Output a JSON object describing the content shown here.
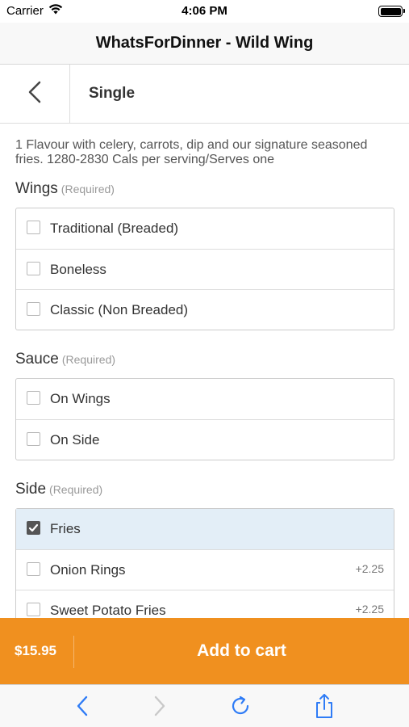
{
  "status_bar": {
    "carrier": "Carrier",
    "time": "4:06 PM"
  },
  "window": {
    "title": "WhatsForDinner - Wild Wing"
  },
  "header": {
    "title": "Single"
  },
  "description": "1 Flavour with celery, carrots, dip and our signature seasoned fries. 1280-2830 Cals per serving/Serves one",
  "groups": {
    "wings": {
      "label": "Wings",
      "required": "(Required)",
      "options": [
        {
          "label": "Traditional (Breaded)",
          "checked": false
        },
        {
          "label": "Boneless",
          "checked": false
        },
        {
          "label": "Classic (Non Breaded)",
          "checked": false
        }
      ]
    },
    "sauce": {
      "label": "Sauce",
      "required": "(Required)",
      "options": [
        {
          "label": "On Wings",
          "checked": false
        },
        {
          "label": "On Side",
          "checked": false
        }
      ]
    },
    "side": {
      "label": "Side",
      "required": "(Required)",
      "options": [
        {
          "label": "Fries",
          "checked": true,
          "price": ""
        },
        {
          "label": "Onion Rings",
          "checked": false,
          "price": "+2.25"
        },
        {
          "label": "Sweet Potato Fries",
          "checked": false,
          "price": "+2.25"
        }
      ]
    }
  },
  "cart": {
    "price": "$15.95",
    "button_label": "Add to cart"
  },
  "toolbar": {
    "icons": [
      "back-arrow-icon",
      "forward-arrow-icon",
      "reload-icon",
      "share-icon"
    ]
  },
  "colors": {
    "accent": "#f0901f",
    "selected_row": "#e3eef7",
    "ios_blue": "#2f7cf6"
  }
}
